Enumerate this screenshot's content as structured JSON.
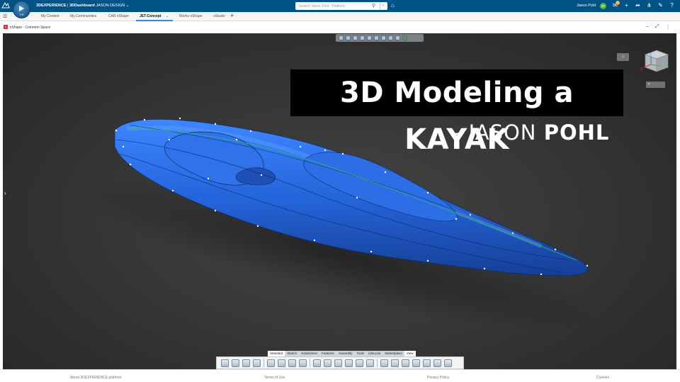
{
  "topbar": {
    "brand": "3DEXPERIENCE",
    "separator": " | ",
    "app": "3DDashboard",
    "dashboard": "JASON DESIGN",
    "compass_version": "V.R",
    "search_placeholder": "Search Jason Pohl - Platform",
    "user_name": "Jason Pohl",
    "user_initials": "JP",
    "notification_count": "34"
  },
  "tabs": [
    "My Content",
    "My Communities",
    "CAR xShape",
    "JET-Concept",
    "Works xShape",
    "xStudio"
  ],
  "widget": {
    "title": "xShape - Common Space"
  },
  "overlay": {
    "title": "3D Modeling a KAYAK",
    "subtitle_prefix": "- JASON ",
    "subtitle_name": "POHL"
  },
  "viewcube": {
    "axis_x": "X",
    "axis_y": "Y",
    "axis_z": "Z"
  },
  "bottom_tabs": [
    "Standard",
    "Sketch",
    "Subdivision",
    "Features",
    "Assembly",
    "Tools",
    "Lifecycle",
    "Marketplace",
    "View"
  ],
  "footer": {
    "about": "About 3DEXPERIENCE platform",
    "terms": "Terms of Use",
    "privacy": "Privacy Policy",
    "cookies": "Cookies"
  },
  "colors": {
    "header": "#005386",
    "kayak": "#2a6fe6",
    "accent": "#368ec4"
  }
}
